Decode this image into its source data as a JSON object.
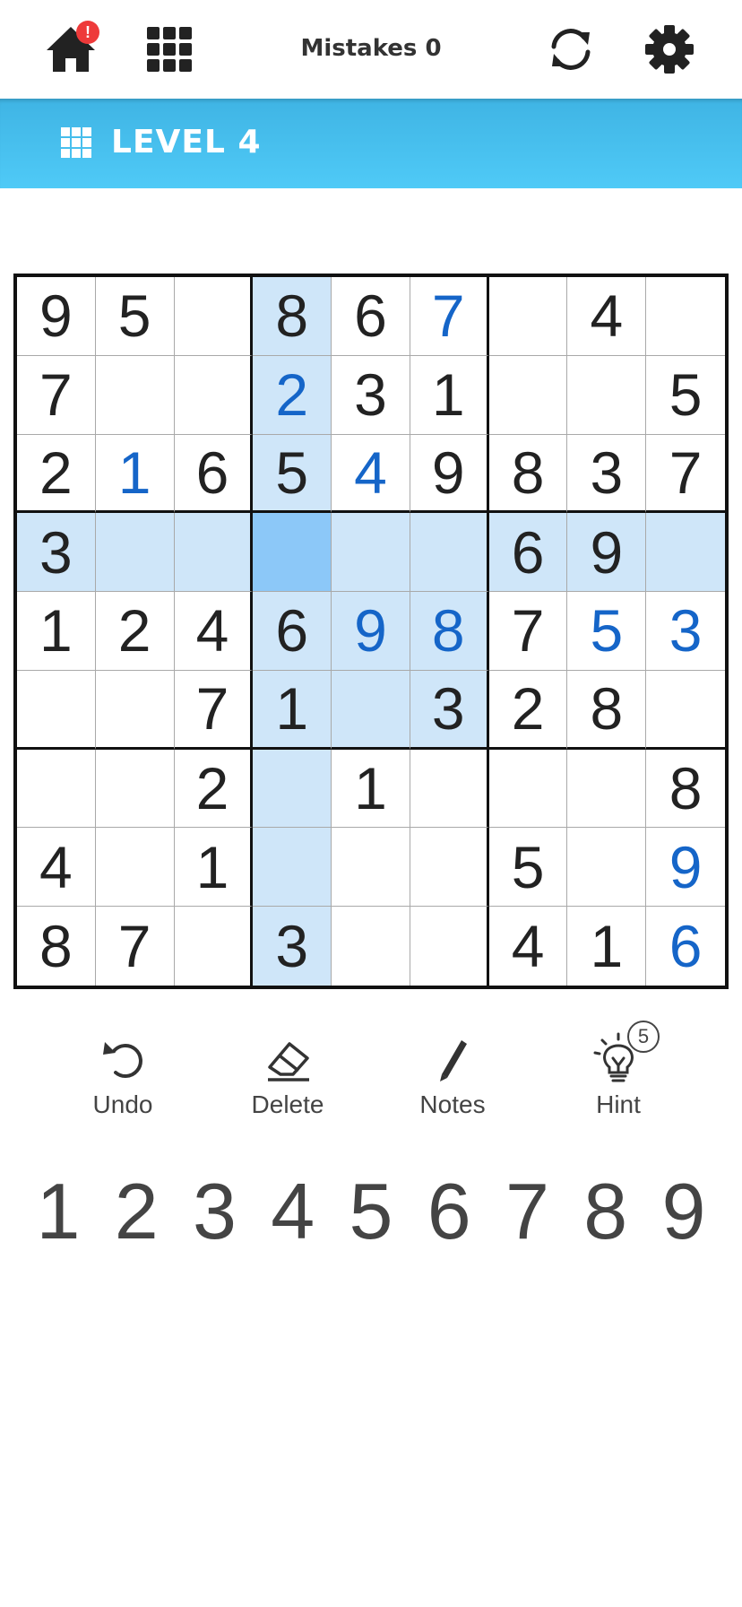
{
  "header": {
    "home_badge": "!",
    "mistakes_label": "Mistakes 0"
  },
  "level": {
    "label": "LEVEL 4"
  },
  "board": {
    "selected": [
      3,
      3
    ],
    "highlight_rows": [
      3
    ],
    "highlight_cols": [
      3
    ],
    "highlight_box": [
      3,
      3
    ],
    "cells": [
      [
        "9",
        "5",
        "",
        "8",
        "6",
        "7",
        "",
        "4",
        ""
      ],
      [
        "7",
        "",
        "",
        "2",
        "3",
        "1",
        "",
        "",
        "5"
      ],
      [
        "2",
        "1",
        "6",
        "5",
        "4",
        "9",
        "8",
        "3",
        "7"
      ],
      [
        "3",
        "",
        "",
        "",
        "",
        "",
        "6",
        "9",
        ""
      ],
      [
        "1",
        "2",
        "4",
        "6",
        "9",
        "8",
        "7",
        "5",
        "3"
      ],
      [
        "",
        "",
        "7",
        "1",
        "",
        "3",
        "2",
        "8",
        ""
      ],
      [
        "",
        "",
        "2",
        "",
        "1",
        "",
        "",
        "",
        "8"
      ],
      [
        "4",
        "",
        "1",
        "",
        "",
        "",
        "5",
        "",
        "9"
      ],
      [
        "8",
        "7",
        "",
        "3",
        "",
        "",
        "4",
        "1",
        "6"
      ]
    ],
    "user_entered": [
      [
        0,
        5
      ],
      [
        1,
        3
      ],
      [
        2,
        1
      ],
      [
        2,
        4
      ],
      [
        4,
        4
      ],
      [
        4,
        5
      ],
      [
        4,
        7
      ],
      [
        4,
        8
      ],
      [
        7,
        8
      ],
      [
        8,
        8
      ]
    ],
    "colors": {
      "given": "#222222",
      "user": "#1565c8",
      "highlight": "#cfe6f9",
      "selected": "#8cc8f8"
    }
  },
  "actions": {
    "undo_label": "Undo",
    "delete_label": "Delete",
    "notes_label": "Notes",
    "hint_label": "Hint",
    "hint_count": "5"
  },
  "numpad": [
    "1",
    "2",
    "3",
    "4",
    "5",
    "6",
    "7",
    "8",
    "9"
  ],
  "icons": {
    "home": "home-icon",
    "menu": "grid-menu-icon",
    "refresh": "refresh-icon",
    "settings": "gear-icon",
    "undo": "undo-icon",
    "delete": "eraser-icon",
    "notes": "pencil-icon",
    "hint": "lightbulb-icon"
  },
  "theme": {
    "level_bar": "#44bfee",
    "text_dark": "#333333"
  }
}
